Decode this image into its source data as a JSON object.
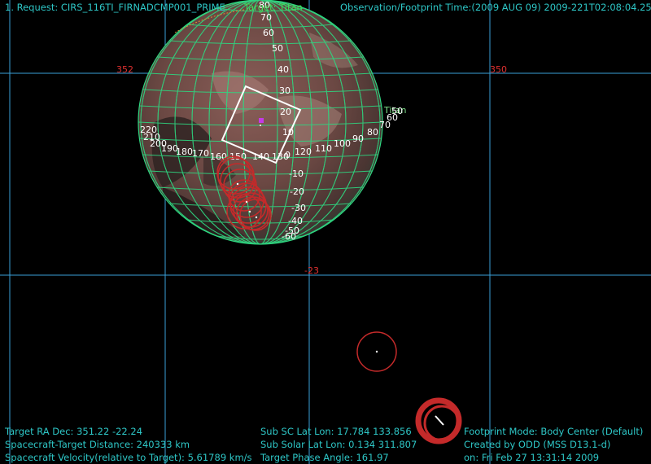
{
  "header": {
    "request": "1. Request: CIRS_116TI_FIRNADCMP001_PRIME",
    "target": "Target: Titan",
    "observation_time": "Observation/Footprint Time:(2009 AUG 09) 2009-221T02:08:04.25"
  },
  "sky_grid": {
    "ra_left": "352",
    "ra_right": "350",
    "dec": "-23"
  },
  "body": {
    "name": "Titan",
    "lat_labels": [
      "80",
      "70",
      "60",
      "50",
      "40",
      "30",
      "20",
      "10",
      "0",
      "-10",
      "-20",
      "-30",
      "-40",
      "-50",
      "-60"
    ],
    "lon_labels": [
      "220",
      "210",
      "200",
      "190",
      "180",
      "170",
      "160",
      "150",
      "140",
      "130",
      "120",
      "110",
      "100",
      "90",
      "80",
      "70",
      "60",
      "50"
    ]
  },
  "footer": {
    "ra_dec": "Target RA Dec: 351.22   -22.24",
    "distance": "Spacecraft-Target Distance:  240333 km",
    "velocity": "Spacecraft Velocity(relative to Target): 5.61789 km/s",
    "sub_sc": "Sub SC Lat Lon: 17.784  133.856",
    "sub_solar": "Sub Solar Lat Lon:  0.134  311.807",
    "phase": "Target Phase Angle: 161.97",
    "footprint_mode": "Footprint Mode: Body Center (Default)",
    "created_by": "Created by ODD (MSS D13.1-d)",
    "created_on": "on: Fri Feb 27 13:31:14 2009"
  },
  "colors": {
    "grid_line": "#3aa0d8",
    "body_grid": "#2fd680",
    "footprint": "#c42a2a",
    "hud_cyan": "#2ec7c7",
    "hud_green": "#3fe05a"
  }
}
